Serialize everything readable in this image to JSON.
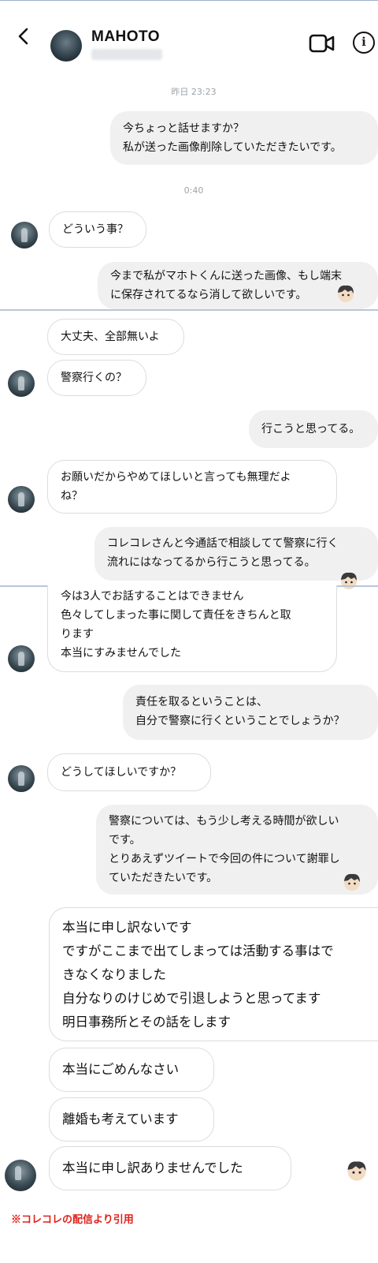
{
  "header": {
    "name": "MAHOTO",
    "back_icon": "chevron-left-icon",
    "video_icon": "video-camera-icon",
    "info_icon": "info-icon",
    "info_glyph": "i"
  },
  "timestamps": {
    "t1": "昨日 23:23",
    "t2": "0:40"
  },
  "messages": {
    "m1": "今ちょっと話せますか？\n私が送った画像削除していただきたいです。",
    "m2": "どういう事？",
    "m3": "今まで私がマホトくんに送った画像、もし端末\nに保存されてるなら消して欲しいです。",
    "m4": "大丈夫、全部無いよ",
    "m5": "警察行くの？",
    "m6": "行こうと思ってる。",
    "m7": "お願いだからやめてほしいと言っても無理だよ\nね？",
    "m8": "コレコレさんと今通話で相談してて警察に行く\n流れにはなってるから行こうと思ってる。",
    "m9": "今は3人でお話することはできません\n色々してしまった事に関して責任をきちんと取\nります\n本当にすみませんでした",
    "m10": "責任を取るということは、\n自分で警察に行くということでしょうか？",
    "m11": "どうしてほしいですか？",
    "m12": "警察については、もう少し考える時間が欲しい\nです。\nとりあえずツイートで今回の件について謝罪し\nていただきたいです。",
    "m13": "本当に申し訳ないです\nですがここまで出てしまっては活動する事はで\nきなくなりました\n自分なりのけじめで引退しようと思ってます\n明日事務所とその話をします",
    "m14": "本当にごめんなさい",
    "m15": "離婚も考えています",
    "m16": "本当に申し訳ありませんでした"
  },
  "caption": "※コレコレの配信より引用",
  "colors": {
    "caption": "#e0211b",
    "bubble_gray": "#f0f0f0",
    "divider": "#b9c6d8"
  }
}
